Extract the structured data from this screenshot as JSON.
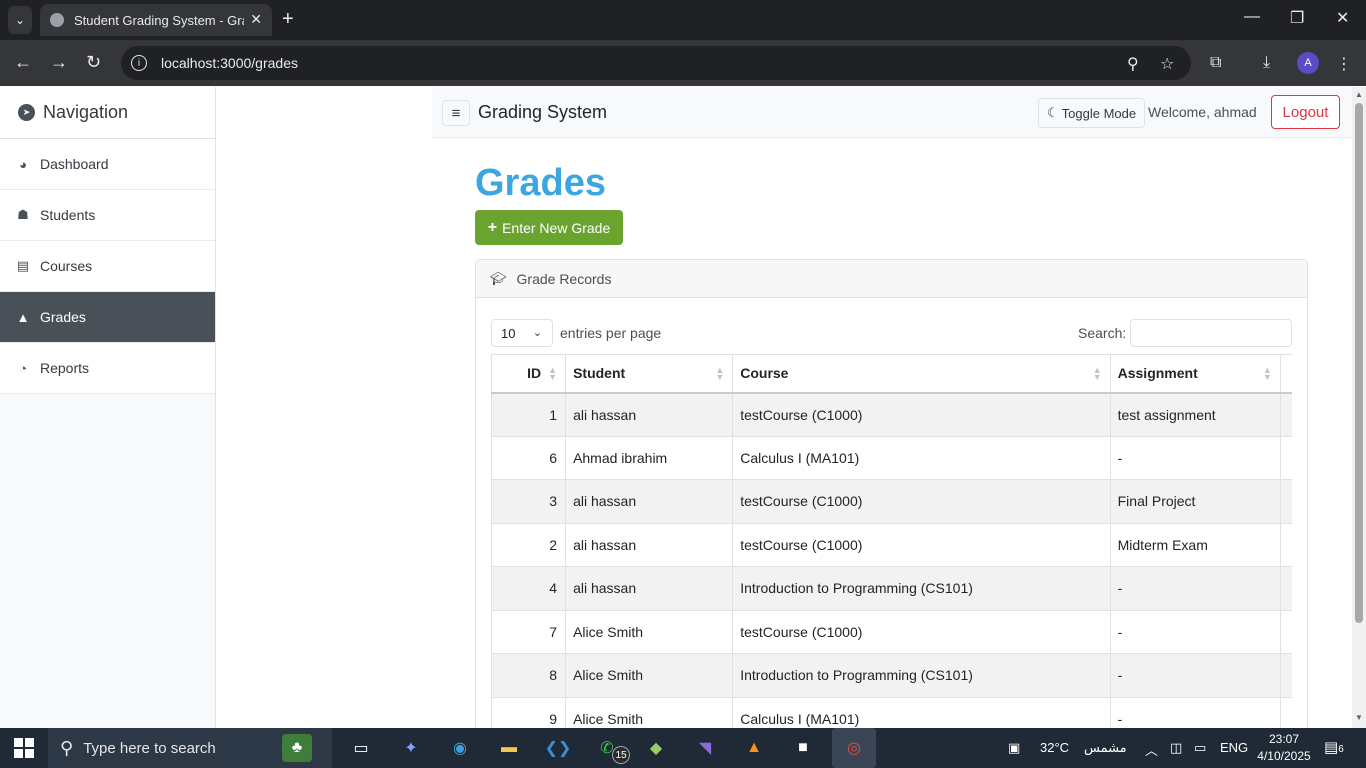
{
  "browser": {
    "tab_title": "Student Grading System - Grades",
    "url": "localhost:3000/grades",
    "profile_initial": "A"
  },
  "sidebar": {
    "heading": "Navigation",
    "items": [
      {
        "label": "Dashboard",
        "icon": "gauge-icon"
      },
      {
        "label": "Students",
        "icon": "students-icon"
      },
      {
        "label": "Courses",
        "icon": "book-icon"
      },
      {
        "label": "Grades",
        "icon": "graduation-cap-icon",
        "active": true
      },
      {
        "label": "Reports",
        "icon": "pie-chart-icon"
      }
    ]
  },
  "topnav": {
    "brand": "Grading System",
    "toggle_label": "Toggle Mode",
    "welcome": "Welcome, ahmad",
    "logout_label": "Logout"
  },
  "main": {
    "title": "Grades",
    "new_button": "Enter New Grade",
    "card_title": "Grade Records",
    "entries_value": "10",
    "entries_label": "entries per page",
    "search_label": "Search:",
    "columns": [
      "ID",
      "Student",
      "Course",
      "Assignment"
    ],
    "rows": [
      {
        "id": "1",
        "student": "ali hassan",
        "course": "testCourse (C1000)",
        "assignment": "test assignment"
      },
      {
        "id": "6",
        "student": "Ahmad ibrahim",
        "course": "Calculus I (MA101)",
        "assignment": "-"
      },
      {
        "id": "3",
        "student": "ali hassan",
        "course": "testCourse (C1000)",
        "assignment": "Final Project"
      },
      {
        "id": "2",
        "student": "ali hassan",
        "course": "testCourse (C1000)",
        "assignment": "Midterm Exam"
      },
      {
        "id": "4",
        "student": "ali hassan",
        "course": "Introduction to Programming (CS101)",
        "assignment": "-"
      },
      {
        "id": "7",
        "student": "Alice Smith",
        "course": "testCourse (C1000)",
        "assignment": "-"
      },
      {
        "id": "8",
        "student": "Alice Smith",
        "course": "Introduction to Programming (CS101)",
        "assignment": "-"
      },
      {
        "id": "9",
        "student": "Alice Smith",
        "course": "Calculus I (MA101)",
        "assignment": "-"
      }
    ]
  },
  "taskbar": {
    "search_placeholder": "Type here to search",
    "whatsapp_badge": "15",
    "weather": "32°C",
    "weather_desc": "مشمس",
    "lang": "ENG",
    "time": "23:07",
    "date": "4/10/2025",
    "notifications": "6"
  },
  "colors": {
    "title": "#3aa7e0",
    "primary_action": "#6aa42f",
    "sidebar_active": "#495057",
    "logout": "#dc3545"
  }
}
